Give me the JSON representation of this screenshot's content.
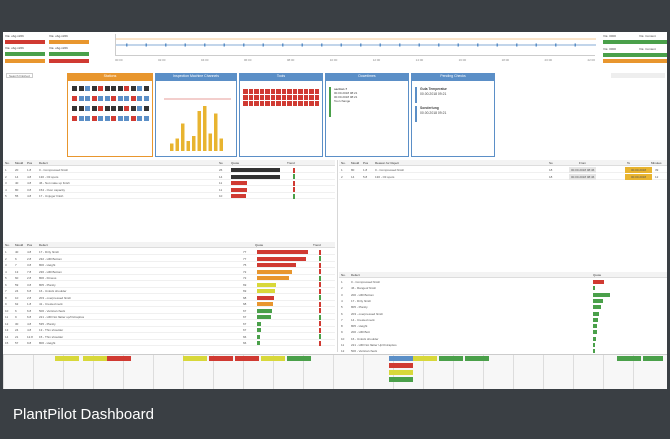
{
  "caption": {
    "text": "PlantPilot Dashboard"
  },
  "panels": [
    {
      "title": "Stations",
      "color": "#e8962e"
    },
    {
      "title": "Inspection Machine Channels",
      "color": "#5b8fc7"
    },
    {
      "title": "Tools",
      "color": "#5b8fc7"
    },
    {
      "title": "Downtimes",
      "color": "#5b8fc7"
    },
    {
      "title": "Pending Checks",
      "color": "#5b8fc7"
    }
  ],
  "downtimes": {
    "heading": "section 7",
    "lines": [
      "00.00.2018 08:21",
      "00.00.2018 08:21",
      "Tool change"
    ]
  },
  "checks": [
    {
      "title": "Gula Temperatur",
      "date": "00.00.2018 09:21"
    },
    {
      "title": "Sonderlung",
      "date": "00.00.2018 09:21"
    }
  ],
  "colors": {
    "red": "#d03a32",
    "orange": "#e8962e",
    "green": "#4aa04a",
    "yellow": "#d8d83a",
    "blue": "#5b8fc7",
    "dark": "#333333"
  },
  "table1": {
    "headers": [
      "No.",
      "Mould",
      "Pos",
      "Defect",
      "So",
      "Quote",
      "Trend"
    ],
    "rows": [
      {
        "c": [
          "1",
          "20",
          "1.8",
          "0 - Compressed finish",
          "26"
        ],
        "v": 0.95,
        "color": "dark"
      },
      {
        "c": [
          "2",
          "14",
          "4.8",
          "130 - Oil spots",
          "14"
        ],
        "v": 0.95,
        "color": "dark"
      },
      {
        "c": [
          "3",
          "40",
          "4.8",
          "46 - Not make up finish",
          "11"
        ],
        "v": 0.3,
        "color": "red"
      },
      {
        "c": [
          "4",
          "80",
          "3.8",
          "154 - Over capacity",
          "11"
        ],
        "v": 0.3,
        "color": "red"
      },
      {
        "c": [
          "5",
          "55",
          "4.8",
          "17 - Unjuger finish",
          "10"
        ],
        "v": 0.28,
        "color": "red"
      }
    ]
  },
  "table2": {
    "headers": [
      "No.",
      "Mould",
      "Pos",
      "Reason for Reject",
      "So",
      "From",
      "To",
      "Minutes"
    ],
    "rows": [
      {
        "c": [
          "1",
          "80",
          "1.8",
          "0 - Compressed finish",
          "18",
          "00.00.2018 08:46",
          "00.00.2018",
          "39"
        ]
      },
      {
        "c": [
          "2",
          "14",
          "5.8",
          "130 - Oil spots",
          "18",
          "00.00.2018 08:46",
          "00.00.2018",
          "12"
        ]
      }
    ]
  },
  "table3": {
    "headers": [
      "No.",
      "Mould",
      "Pos",
      "Defect",
      "",
      "Quote",
      "Trend"
    ],
    "rows": [
      {
        "c": [
          "1",
          "40",
          "4.8",
          "17 - Dirty finish",
          "77"
        ],
        "v": 0.95,
        "color": "red"
      },
      {
        "c": [
          "2",
          "6",
          "2.8",
          "232 - Hfill Bottom",
          "77"
        ],
        "v": 0.9,
        "color": "red"
      },
      {
        "c": [
          "3",
          "7",
          "3.8",
          "806 - Height",
          "75"
        ],
        "v": 0.72,
        "color": "red"
      },
      {
        "c": [
          "4",
          "13",
          "7.8",
          "236 - Hfill Bottom",
          "72"
        ],
        "v": 0.65,
        "color": "orange"
      },
      {
        "c": [
          "5",
          "60",
          "2.8",
          "806 - Fitness",
          "72"
        ],
        "v": 0.6,
        "color": "orange"
      },
      {
        "c": [
          "6",
          "59",
          "3.8",
          "805 - Planity",
          "69"
        ],
        "v": 0.35,
        "color": "yellow"
      },
      {
        "c": [
          "7",
          "24",
          "6.8",
          "16 - Unlock shoulder",
          "69"
        ],
        "v": 0.33,
        "color": "yellow"
      },
      {
        "c": [
          "8",
          "10",
          "2.8",
          "203 - overpressed finish",
          "68"
        ],
        "v": 0.32,
        "color": "red"
      },
      {
        "c": [
          "9",
          "62",
          "1.8",
          "41 - Crested neck",
          "68"
        ],
        "v": 0.3,
        "color": "orange"
      },
      {
        "c": [
          "10",
          "6",
          "6.8",
          "506 - Vertical check",
          "67"
        ],
        "v": 0.28,
        "color": "green"
      },
      {
        "c": [
          "11",
          "9",
          "6.8",
          "221 - Hfill Not flatter up/Oxtrapitos",
          "67"
        ],
        "v": 0.25,
        "color": "green"
      },
      {
        "c": [
          "12",
          "30",
          "4.8",
          "535 - Planity",
          "67"
        ],
        "v": 0.08,
        "color": "green"
      },
      {
        "c": [
          "13",
          "24",
          "4.8",
          "13 - Thin shoulder",
          "67"
        ],
        "v": 0.07,
        "color": "green"
      },
      {
        "c": [
          "14",
          "21",
          "12.8",
          "15 - Thin shoulder",
          "66"
        ],
        "v": 0.06,
        "color": "green"
      },
      {
        "c": [
          "15",
          "57",
          "9.8",
          "806 - Height",
          "66"
        ],
        "v": 0.05,
        "color": "green"
      }
    ]
  },
  "table4": {
    "headers": [
      "No.",
      "Defect",
      "Quote"
    ],
    "rows": [
      {
        "c": [
          "1",
          "0 - Compressed finish"
        ],
        "v": 0.55,
        "color": "red"
      },
      {
        "c": [
          "2",
          "46 - Rangeof finish"
        ],
        "v": 0.1,
        "color": "green"
      },
      {
        "c": [
          "3",
          "200 - Hfill Bottom"
        ],
        "v": 0.85,
        "color": "green"
      },
      {
        "c": [
          "4",
          "17 - Dirty finish"
        ],
        "v": 0.5,
        "color": "green"
      },
      {
        "c": [
          "5",
          "805 - Planity"
        ],
        "v": 0.4,
        "color": "green"
      },
      {
        "c": [
          "6",
          "203 - overpressed finish"
        ],
        "v": 0.3,
        "color": "green"
      },
      {
        "c": [
          "7",
          "14 - Crested neck"
        ],
        "v": 0.25,
        "color": "green"
      },
      {
        "c": [
          "8",
          "805 - Height"
        ],
        "v": 0.22,
        "color": "green"
      },
      {
        "c": [
          "9",
          "200 - Hfill Bott"
        ],
        "v": 0.2,
        "color": "green"
      },
      {
        "c": [
          "10",
          "16 - Unlock shoulder"
        ],
        "v": 0.15,
        "color": "green"
      },
      {
        "c": [
          "11",
          "221 - Hfill Not flatter Up/Oxtrapitos"
        ],
        "v": 0.12,
        "color": "green"
      },
      {
        "c": [
          "12",
          "506 - Vertical check"
        ],
        "v": 0.1,
        "color": "green"
      }
    ]
  },
  "top_kpis": [
    {
      "label": "V.E. obg.mhflt",
      "label2": "V.E. obg.mhflt",
      "value": "95.7 %",
      "color": "red"
    },
    {
      "label": "V.E. obg.mhflt",
      "label2": "V.E. obg.mhflt",
      "value": "85.4 %",
      "color": "green"
    },
    {
      "label": "V.E. obg.mhflt",
      "label2": "V.E. obg.mhflt",
      "value": "80.3 %",
      "color": "orange"
    }
  ],
  "right_kpis": [
    {
      "label": "V.E. 0000",
      "label2": "V.E. Content",
      "color": "green"
    },
    {
      "label": "V.E. 0000",
      "label2": "V.E. Content",
      "color": "green"
    },
    {
      "label": "V.E. 0000",
      "label2": "V.E. Content",
      "color": "orange"
    }
  ],
  "timeline_ticks": [
    "00:00",
    "02:00",
    "04:00",
    "06:00",
    "08:00",
    "10:00",
    "12:00",
    "14:00",
    "16:00",
    "18:00",
    "20:00",
    "22:00"
  ],
  "filter_label": "Search finished"
}
